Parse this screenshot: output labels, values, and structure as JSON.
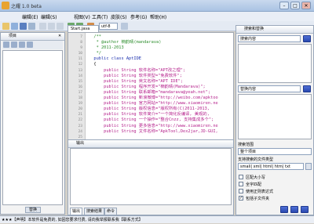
{
  "window": {
    "title": "之耀 1.0 beta",
    "minimize": "–",
    "maximize": "□",
    "close": "✕"
  },
  "menu": [
    "编辑(E)",
    "编辑(S)",
    "视图(V)",
    "工具(T)",
    "皮肤(S)",
    "参考(G)",
    "帮助(H)"
  ],
  "toolbar": {
    "encoding": "utf-8"
  },
  "project_panel": {
    "title": "项目",
    "button": "替换"
  },
  "editor": {
    "tab_label": "Start.java",
    "line_numbers": [
      "7",
      "8",
      "9",
      "10",
      "11",
      "12",
      "13",
      "14",
      "15",
      "16",
      "17",
      "18",
      "19",
      "20",
      "21",
      "22",
      "23",
      "24",
      "25",
      "26"
    ],
    "lines": [
      {
        "text": "  /**",
        "cls": "c-comment"
      },
      {
        "text": "   * @author 楠韵晴(mandarava)",
        "cls": "c-comment"
      },
      {
        "text": "   * 2011-2013",
        "cls": "c-comment"
      },
      {
        "text": "   */",
        "cls": "c-comment"
      },
      {
        "text": "  public class AptIDE",
        "cls": "c-kw"
      },
      {
        "text": "  {",
        "cls": ""
      },
      {
        "text": "      public String 软件名称=\"APT改之理\";",
        "cls": "c-str"
      },
      {
        "text": "      public String 软件类型=\"免费软件\";",
        "cls": "c-str"
      },
      {
        "text": "      public String 英文名称=\"APT IDE\";",
        "cls": "c-str"
      },
      {
        "text": "      public String 程序开发=\"楠韵晴(Mandarava)\";",
        "cls": "c-str"
      },
      {
        "text": "      public String 联系邮箱=\"mandarava@yeah.net\";",
        "cls": "c-str"
      },
      {
        "text": "      public String 新浪微博=\"http://weibo.com/apktoo",
        "cls": "c-str"
      },
      {
        "text": "      public String 官方网站=\"http://www.xiaomiren.ne",
        "cls": "c-str"
      },
      {
        "text": "      public String 版权信息=\"版权所有(C)2011-2013,",
        "cls": "c-str"
      },
      {
        "text": "      public String 软件简介=\"一个简化反编译, 美观的,",
        "cls": "c-str"
      },
      {
        "text": "      public String 一个操作=\"整合Cnzz, 支持集成多个\";",
        "cls": "c-str"
      },
      {
        "text": "      public String 更多信息=\"http://www.xiaomiren.ne",
        "cls": "c-str"
      },
      {
        "text": "      public String 文件名称=\"ApkTool,Dex2jar,JD-GUI,",
        "cls": "c-str"
      },
      {
        "text": "",
        "cls": ""
      },
      {
        "text": "",
        "cls": ""
      }
    ]
  },
  "output_panel": {
    "title": "输出",
    "tabs": [
      "输出",
      "搜索结果",
      "命令"
    ]
  },
  "search_panel": {
    "title": "搜索和替换",
    "search_label": "搜索内容",
    "replace_label": "替换内容",
    "scope_label": "搜索范围",
    "scope_value": "整个项目",
    "types_label": "支持搜索的文件类型",
    "types_value": "smali| xml| html| htm| txt",
    "options": [
      {
        "label": "区配大小写",
        "checked": false
      },
      {
        "label": "全字匹配",
        "checked": false
      },
      {
        "label": "使用正则表达式",
        "checked": false
      },
      {
        "label": "包括子文件夹",
        "checked": true
      }
    ]
  },
  "statusbar": {
    "text": "★★★【声明】本软件是免费的, 如因您要求付费, 请向我举报联系我【联系方式】"
  }
}
